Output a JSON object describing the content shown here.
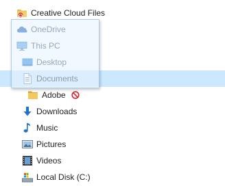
{
  "navigation_pane": {
    "items": [
      {
        "label": "Creative Cloud Files",
        "icon": "creative-cloud-folder-icon"
      },
      {
        "label": "OneDrive",
        "icon": "onedrive-cloud-icon"
      },
      {
        "label": "This PC",
        "icon": "monitor-icon"
      },
      {
        "label": "Desktop",
        "icon": "desktop-icon"
      },
      {
        "label": "Documents",
        "icon": "documents-icon",
        "selected": true
      },
      {
        "label": "Adobe",
        "icon": "folder-icon",
        "status_icon": "no-drop-icon"
      },
      {
        "label": "Downloads",
        "icon": "download-arrow-icon"
      },
      {
        "label": "Music",
        "icon": "music-note-icon"
      },
      {
        "label": "Pictures",
        "icon": "pictures-icon"
      },
      {
        "label": "Videos",
        "icon": "film-strip-icon"
      },
      {
        "label": "Local Disk (C:)",
        "icon": "drive-icon"
      }
    ]
  },
  "colors": {
    "selection": "#cce8ff",
    "folder_yellow": "#e8b84a",
    "accent_blue": "#1e73c8",
    "no_drop_red": "#d9232a"
  }
}
